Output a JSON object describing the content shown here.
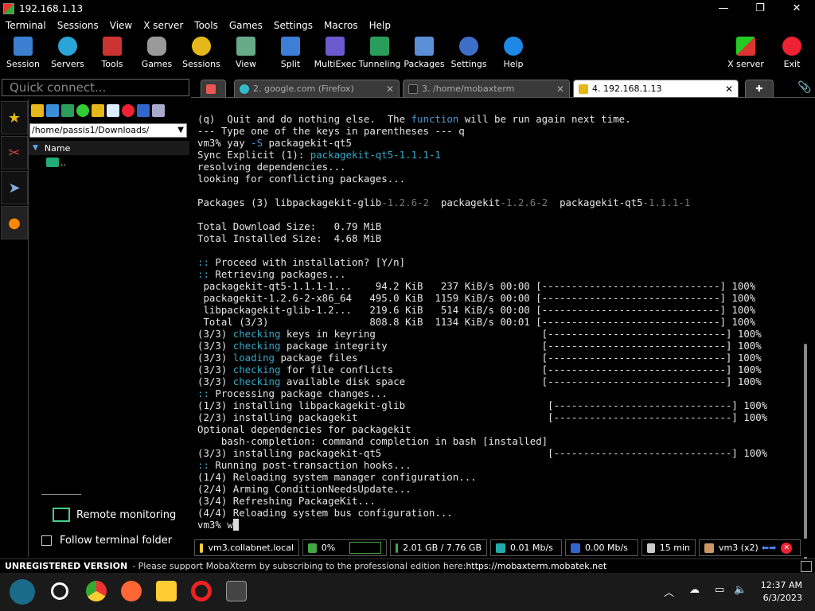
{
  "window": {
    "title": "192.168.1.13",
    "controls": [
      "—",
      "❐",
      "✕"
    ]
  },
  "menu": [
    "Terminal",
    "Sessions",
    "View",
    "X server",
    "Tools",
    "Games",
    "Settings",
    "Macros",
    "Help"
  ],
  "toolbar": {
    "session": "Session",
    "servers": "Servers",
    "tools": "Tools",
    "games": "Games",
    "sessions": "Sessions",
    "view": "View",
    "split": "Split",
    "multiexec": "MultiExec",
    "tunneling": "Tunneling",
    "packages": "Packages",
    "settings": "Settings",
    "help": "Help",
    "xserver": "X server",
    "exit": "Exit"
  },
  "quick_connect": {
    "placeholder": "Quick connect..."
  },
  "tabs": [
    {
      "label": "2. google.com (Firefox)"
    },
    {
      "label": "3. /home/mobaxterm"
    },
    {
      "label": "4. 192.168.1.13"
    }
  ],
  "filepanel": {
    "path": "/home/passis1/Downloads/",
    "column": "Name",
    "rows": [
      ".."
    ],
    "remote_monitoring": "Remote monitoring",
    "follow_folder": "Follow terminal folder"
  },
  "terminal": {
    "l1a": "(q)  Quit and do nothing else.  The ",
    "l1b": "function",
    "l1c": " will be run again next time.",
    "l2": "--- Type one of the keys in parentheses --- q",
    "l3a": "vm3% yay ",
    "l3b": "-S",
    "l3c": " packagekit-qt5",
    "l4a": "Sync Explicit (1): ",
    "l4b": "packagekit-qt5-1.1.1-1",
    "l5": "resolving dependencies...",
    "l6": "looking for conflicting packages...",
    "l7": "",
    "l8a": "Packages (3) libpackagekit-glib",
    "l8b": "-1.2.6-2",
    "l8c": "  packagekit",
    "l8d": "-1.2.6-2",
    "l8e": "  packagekit-qt5",
    "l8f": "-1.1.1-1",
    "l9": "",
    "l10": "Total Download Size:   0.79 MiB",
    "l11": "Total Installed Size:  4.68 MiB",
    "l12": "",
    "l13a": "::",
    "l13b": " Proceed with installation? [Y/n]",
    "l14a": "::",
    "l14b": " Retrieving packages...",
    "l15": " packagekit-qt5-1.1.1-1...    94.2 KiB   237 KiB/s 00:00 [------------------------------] 100%",
    "l16": " packagekit-1.2.6-2-x86_64   495.0 KiB  1159 KiB/s 00:00 [------------------------------] 100%",
    "l17": " libpackagekit-glib-1.2...   219.6 KiB   514 KiB/s 00:00 [------------------------------] 100%",
    "l18": " Total (3/3)                 808.8 KiB  1134 KiB/s 00:01 [------------------------------] 100%",
    "l19a": "(3/3) ",
    "l19b": "checking",
    "l19c": " keys in keyring                            [------------------------------] 100%",
    "l20a": "(3/3) ",
    "l20b": "checking",
    "l20c": " package integrity                          [------------------------------] 100%",
    "l21a": "(3/3) ",
    "l21b": "loading",
    "l21c": " package files                               [------------------------------] 100%",
    "l22a": "(3/3) ",
    "l22b": "checking",
    "l22c": " for file conflicts                         [------------------------------] 100%",
    "l23a": "(3/3) ",
    "l23b": "checking",
    "l23c": " available disk space                       [------------------------------] 100%",
    "l24a": "::",
    "l24b": " Processing package changes...",
    "l25": "(1/3) installing libpackagekit-glib                        [------------------------------] 100%",
    "l26": "(2/3) installing packagekit                                [------------------------------] 100%",
    "l27": "Optional dependencies for packagekit",
    "l28": "    bash-completion: command completion in bash [installed]",
    "l29": "(3/3) installing packagekit-qt5                            [------------------------------] 100%",
    "l30a": "::",
    "l30b": " Running post-transaction hooks...",
    "l31": "(1/4) Reloading system manager configuration...",
    "l32": "(2/4) Arming ConditionNeedsUpdate...",
    "l33": "(3/4) Refreshing PackageKit...",
    "l34": "(4/4) Reloading system bus configuration...",
    "l35a": "vm3% ",
    "l35b": "w"
  },
  "status": {
    "host": "vm3.collabnet.local",
    "cpu": "0%",
    "memory": "2.01 GB / 7.76 GB",
    "upload": "0.01 Mb/s",
    "download": "0.00 Mb/s",
    "uptime": "15 min",
    "user": "vm3 (x2)"
  },
  "banner": {
    "title": "UNREGISTERED VERSION",
    "text": " -  Please support MobaXterm by subscribing to the professional edition here:  ",
    "link": "https://mobaxterm.mobatek.net"
  },
  "clock": {
    "time": "12:37 AM",
    "date": "6/3/2023"
  },
  "colors": {
    "cyan": "#35a9c9",
    "blue": "#4a9bd8",
    "grey": "#777777"
  }
}
